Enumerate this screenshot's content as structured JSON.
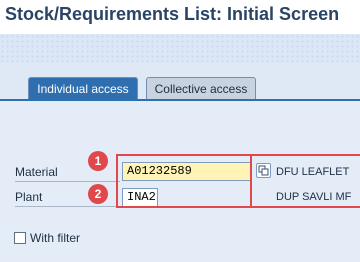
{
  "window": {
    "title": "Stock/Requirements List: Initial Screen"
  },
  "tabs": [
    {
      "label": "Individual access",
      "active": true
    },
    {
      "label": "Collective access",
      "active": false
    }
  ],
  "form": {
    "material": {
      "label": "Material",
      "value": "A01232589",
      "description": "DFU LEAFLET"
    },
    "plant": {
      "label": "Plant",
      "value": "INA2",
      "description": "DUP SAVLI MF"
    },
    "with_filter": {
      "label": "With filter",
      "checked": false
    }
  },
  "annotations": {
    "step1": "1",
    "step2": "2",
    "color": "#e0484b"
  },
  "icons": {
    "matchcode": "matchcode-icon"
  },
  "colors": {
    "accent": "#2f6fb0",
    "highlight": "#e0484b",
    "required_field": "#fff3b5"
  }
}
